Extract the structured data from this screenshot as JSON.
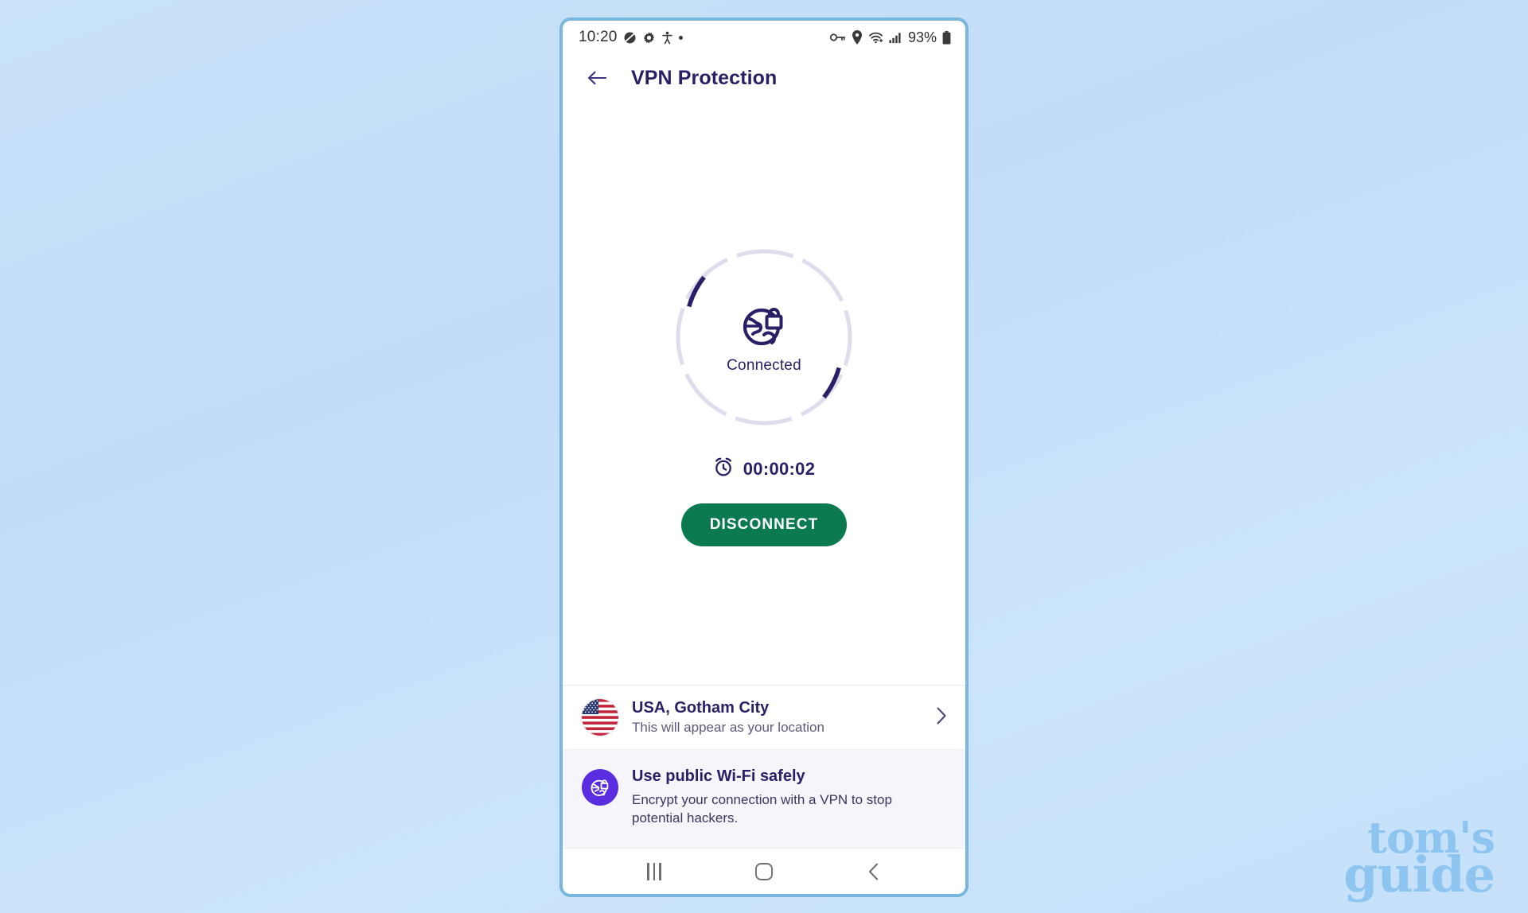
{
  "background": {
    "color_top": "#c9e2f9",
    "color_bottom": "#c5e0f9"
  },
  "watermark": {
    "line1": "tom's",
    "line2": "guide",
    "color": "#8ec5f0"
  },
  "phone": {
    "frame_color": "#79b6dc",
    "status_bar": {
      "time": "10:20",
      "left_icons": [
        "mute-icon",
        "gear-icon",
        "accessibility-icon",
        "dot-icon"
      ],
      "right_icons": [
        "vpn-key-icon",
        "location-pin-icon",
        "wifi-icon",
        "cellular-signal-icon"
      ],
      "battery_percent": "93%",
      "battery_icon": "battery-icon"
    },
    "app_bar": {
      "back_icon": "back-arrow-icon",
      "title": "VPN Protection",
      "title_color": "#2a1e66"
    },
    "status_ring": {
      "label": "Connected",
      "center_icon": "globe-lock-icon",
      "active_color": "#2a1e66",
      "inactive_color": "#dfdcec",
      "segments_total": 8,
      "segments_active": [
        1,
        5
      ]
    },
    "timer": {
      "icon": "alarm-clock-icon",
      "value": "00:00:02"
    },
    "primary_button": {
      "label": "DISCONNECT",
      "background": "#0c7a50",
      "text_color": "#ffffff"
    },
    "location_row": {
      "flag_icon": "usa-flag-icon",
      "title": "USA, Gotham City",
      "subtitle": "This will appear as your location",
      "chevron_icon": "chevron-right-icon"
    },
    "tip_card": {
      "icon": "globe-lock-icon",
      "icon_background": "#5b2de0",
      "title": "Use public Wi-Fi safely",
      "description": "Encrypt your connection with a VPN to stop potential hackers."
    },
    "nav_bar": {
      "recents_icon": "recents-icon",
      "home_icon": "home-icon",
      "back_icon": "nav-back-icon"
    }
  }
}
